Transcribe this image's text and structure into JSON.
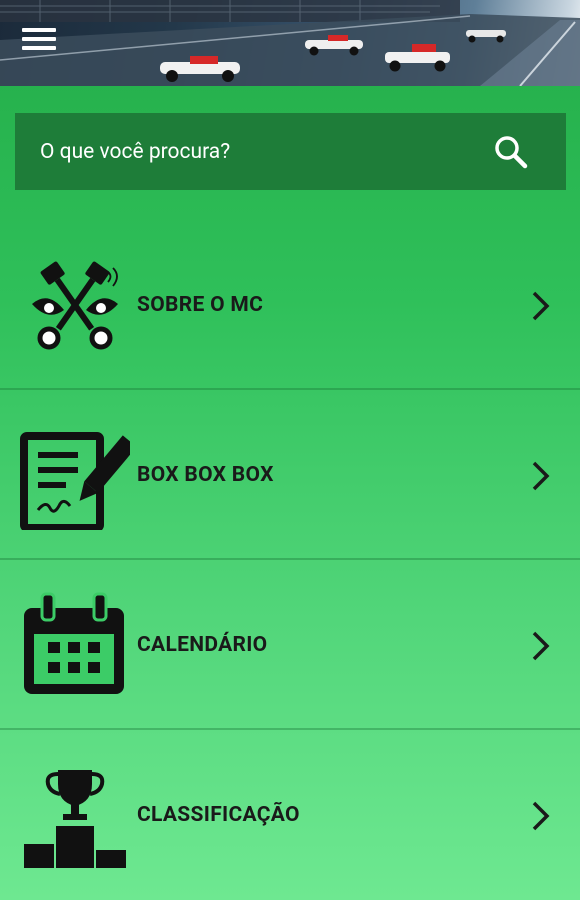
{
  "header": {
    "menu_icon": "hamburger-menu-icon",
    "background": "race-track-banner-image"
  },
  "search": {
    "placeholder": "O que você procura?",
    "value": "",
    "icon": "search-icon"
  },
  "menu": {
    "items": [
      {
        "label": "SOBRE O MC",
        "icon": "crossed-pistons-icon"
      },
      {
        "label": "BOX BOX BOX",
        "icon": "signed-document-icon"
      },
      {
        "label": "CALENDÁRIO",
        "icon": "calendar-icon"
      },
      {
        "label": "CLASSIFICAÇÃO",
        "icon": "podium-trophy-icon"
      }
    ],
    "chevron_icon": "chevron-right-icon"
  },
  "colors": {
    "background_top": "#23ac48",
    "background_bottom": "#6ee891",
    "search_bar": "#1e7d39",
    "text": "#1a1a1a"
  }
}
